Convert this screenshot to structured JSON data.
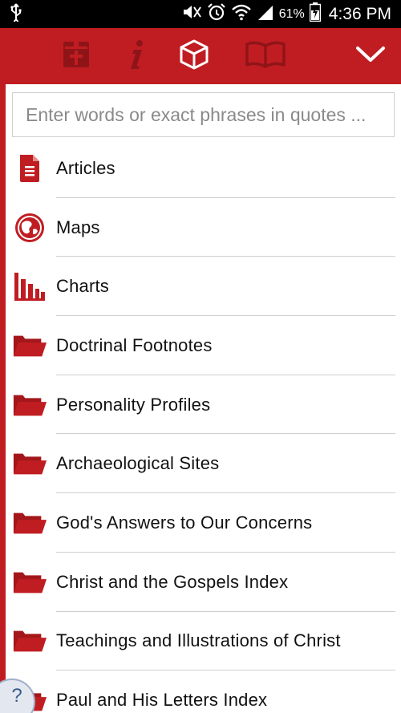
{
  "status": {
    "battery_pct": "61%",
    "time": "4:36 PM"
  },
  "toolbar": {
    "icons": [
      "bible-icon",
      "info-icon",
      "cube-icon",
      "book-icon",
      "chevron-down-icon"
    ]
  },
  "search": {
    "placeholder": "Enter words or exact phrases in quotes ..."
  },
  "items": [
    {
      "label": "Articles",
      "icon": "document-icon"
    },
    {
      "label": "Maps",
      "icon": "globe-icon"
    },
    {
      "label": "Charts",
      "icon": "bar-chart-icon"
    },
    {
      "label": "Doctrinal Footnotes",
      "icon": "folder-icon"
    },
    {
      "label": "Personality Profiles",
      "icon": "folder-icon"
    },
    {
      "label": "Archaeological Sites",
      "icon": "folder-icon"
    },
    {
      "label": "God's Answers to Our Concerns",
      "icon": "folder-icon"
    },
    {
      "label": "Christ and the Gospels Index",
      "icon": "folder-icon"
    },
    {
      "label": "Teachings and Illustrations of Christ",
      "icon": "folder-icon"
    },
    {
      "label": "Paul and His Letters Index",
      "icon": "folder-icon"
    }
  ],
  "help": {
    "label": "?"
  },
  "colors": {
    "accent": "#c01d22",
    "dim_icon": "#8f1418",
    "white": "#ffffff"
  }
}
